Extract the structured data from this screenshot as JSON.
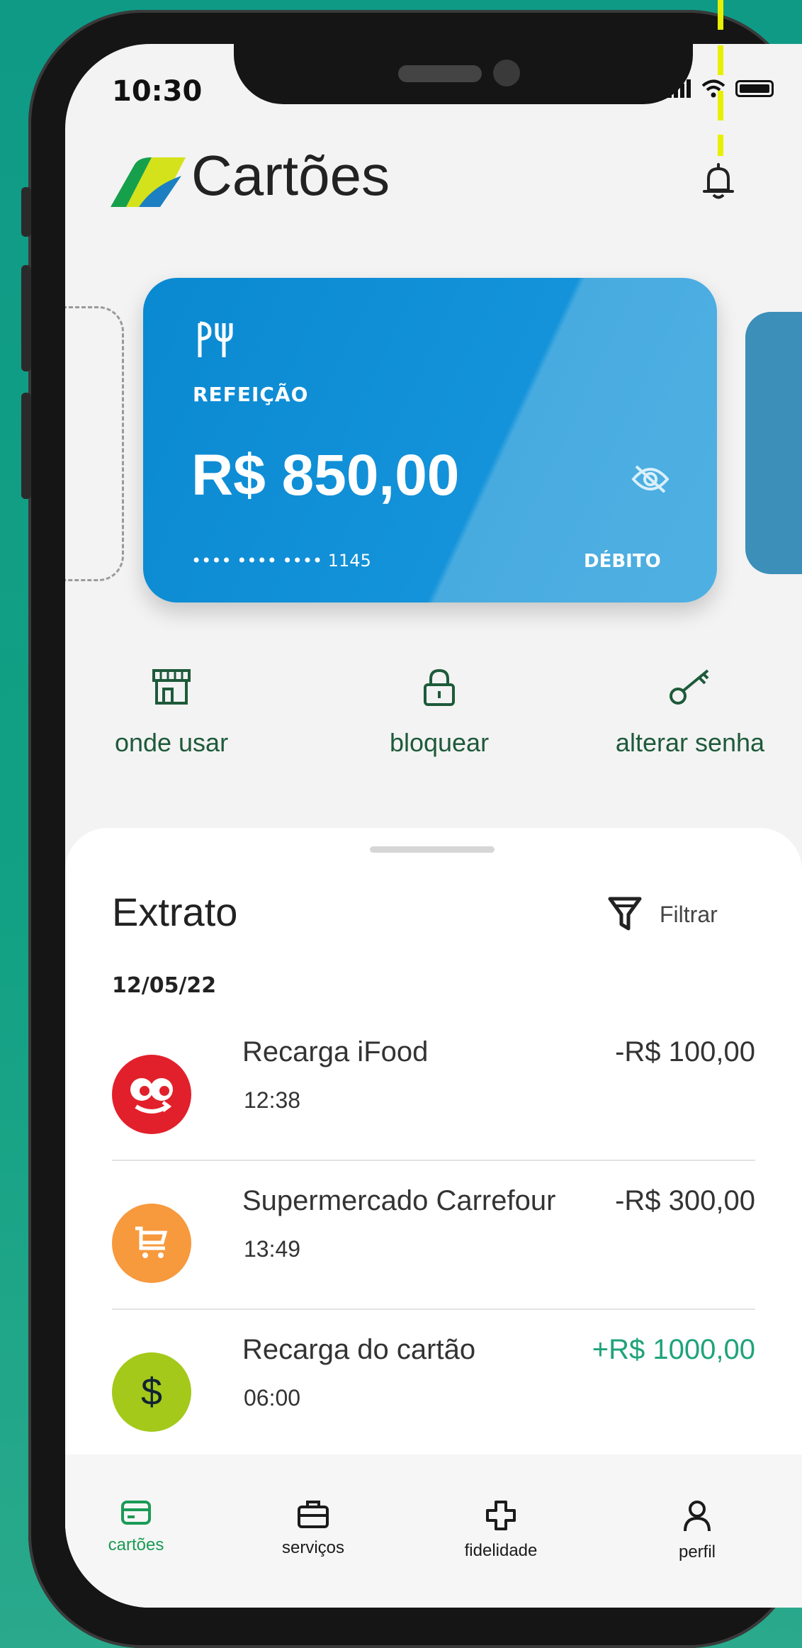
{
  "status_bar": {
    "time": "10:30"
  },
  "header": {
    "title": "Cartões"
  },
  "card": {
    "type": "REFEIÇÃO",
    "balance": "R$ 850,00",
    "number": "•••• •••• •••• 1145",
    "mode": "DÉBITO"
  },
  "actions": [
    {
      "label": "onde usar",
      "icon": "store-icon"
    },
    {
      "label": "bloquear",
      "icon": "lock-icon"
    },
    {
      "label": "alterar senha",
      "icon": "key-icon"
    }
  ],
  "statement": {
    "title": "Extrato",
    "filter_label": "Filtrar",
    "date": "12/05/22",
    "transactions": [
      {
        "name": "Recarga iFood",
        "time": "12:38",
        "amount": "-R$ 100,00",
        "icon": "ifood-logo-icon",
        "color": "#e2202b"
      },
      {
        "name": "Supermercado Carrefour",
        "time": "13:49",
        "amount": "-R$ 300,00",
        "icon": "shopping-cart-icon",
        "color": "#f7993d"
      },
      {
        "name": "Recarga do cartão",
        "time": "06:00",
        "amount": "+R$ 1000,00",
        "icon": "dollar-icon",
        "color": "#a4c91a",
        "amount_color": "#1fa37a"
      }
    ]
  },
  "tabbar": {
    "items": [
      {
        "label": "cartões",
        "icon": "card-icon",
        "active": true
      },
      {
        "label": "serviços",
        "icon": "briefcase-icon",
        "active": false
      },
      {
        "label": "fidelidade",
        "icon": "plus-icon",
        "active": false
      },
      {
        "label": "perfil",
        "icon": "user-icon",
        "active": false
      }
    ]
  },
  "colors": {
    "background": "#12a184",
    "accent_green": "#1e5a3a",
    "card_blue": "#0a89d1",
    "positive": "#1fa37a",
    "active_tab": "#1b9a55"
  }
}
